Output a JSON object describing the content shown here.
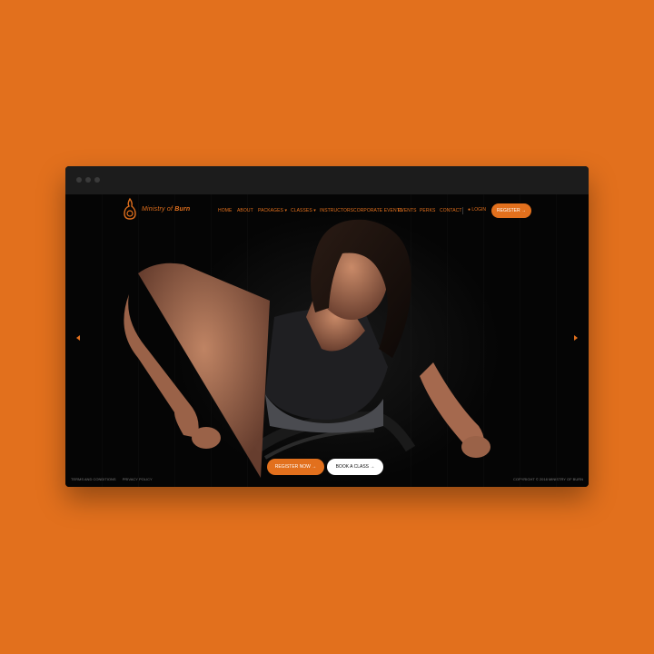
{
  "brand": {
    "name_prefix": "Ministry of",
    "name_suffix": "Burn",
    "accent_color": "#E2701D",
    "background_color": "#E2701D"
  },
  "nav": {
    "items": [
      {
        "label": "Home"
      },
      {
        "label": "About"
      },
      {
        "label": "Packages",
        "icon": "caret-down-icon"
      },
      {
        "label": "Classes",
        "icon": "caret-down-icon"
      },
      {
        "label": "Instructors"
      },
      {
        "label": "Corporate Events"
      },
      {
        "label": "Events"
      },
      {
        "label": "Perks"
      },
      {
        "label": "Contact"
      }
    ],
    "login_label": "Login",
    "register_label": "Register"
  },
  "hero": {
    "register_now_label": "Register Now",
    "book_class_label": "Book a Class",
    "prev_icon": "chevron-left-icon",
    "next_icon": "chevron-right-icon"
  },
  "footer": {
    "terms_label": "Terms and Conditions",
    "privacy_label": "Privacy Policy",
    "copyright": "Copyright © 2018 Ministry of Burn"
  }
}
